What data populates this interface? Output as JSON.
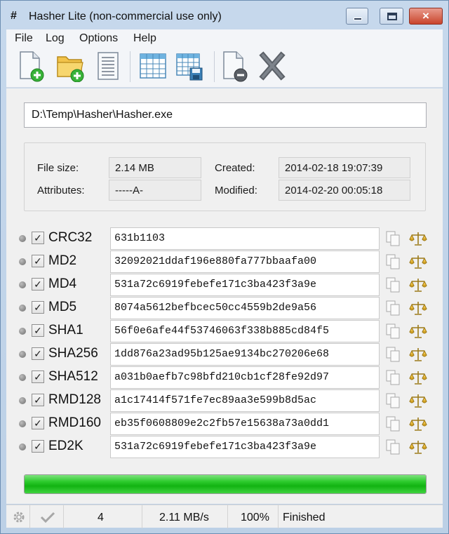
{
  "window": {
    "app_icon": "#",
    "title": "Hasher Lite (non-commercial use only)",
    "controls": {
      "minimize": "minimize-icon",
      "maximize": "maximize-icon",
      "close": "×"
    }
  },
  "menu": [
    "File",
    "Log",
    "Options",
    "Help"
  ],
  "toolbar": {
    "buttons": [
      "add-file-icon",
      "add-folder-icon",
      "text-document-icon",
      "table-icon",
      "save-table-icon",
      "remove-file-icon",
      "delete-icon"
    ]
  },
  "file": {
    "path": "D:\\Temp\\Hasher\\Hasher.exe",
    "size_label": "File size:",
    "size": "2.14 MB",
    "attributes_label": "Attributes:",
    "attributes": "-----A-",
    "created_label": "Created:",
    "created": "2014-02-18 19:07:39",
    "modified_label": "Modified:",
    "modified": "2014-02-20 00:05:18"
  },
  "hashes": [
    {
      "name": "CRC32",
      "checked": "✓",
      "value": "631b1103"
    },
    {
      "name": "MD2",
      "checked": "✓",
      "value": "32092021ddaf196e880fa777bbaafa00"
    },
    {
      "name": "MD4",
      "checked": "✓",
      "value": "531a72c6919febefe171c3ba423f3a9e"
    },
    {
      "name": "MD5",
      "checked": "✓",
      "value": "8074a5612befbcec50cc4559b2de9a56"
    },
    {
      "name": "SHA1",
      "checked": "✓",
      "value": "56f0e6afe44f53746063f338b885cd84f5"
    },
    {
      "name": "SHA256",
      "checked": "✓",
      "value": "1dd876a23ad95b125ae9134bc270206e68"
    },
    {
      "name": "SHA512",
      "checked": "✓",
      "value": "a031b0aefb7c98bfd210cb1cf28fe92d97"
    },
    {
      "name": "RMD128",
      "checked": "✓",
      "value": "a1c17414f571fe7ec89aa3e599b8d5ac"
    },
    {
      "name": "RMD160",
      "checked": "✓",
      "value": "eb35f0608809e2c2fb57e15638a73a0dd1"
    },
    {
      "name": "ED2K",
      "checked": "✓",
      "value": "531a72c6919febefe171c3ba423f3a9e"
    }
  ],
  "progress": {
    "percent": 100,
    "color": "#22c022"
  },
  "status": {
    "count": "4",
    "speed": "2.11 MB/s",
    "percent": "100%",
    "state": "Finished"
  }
}
